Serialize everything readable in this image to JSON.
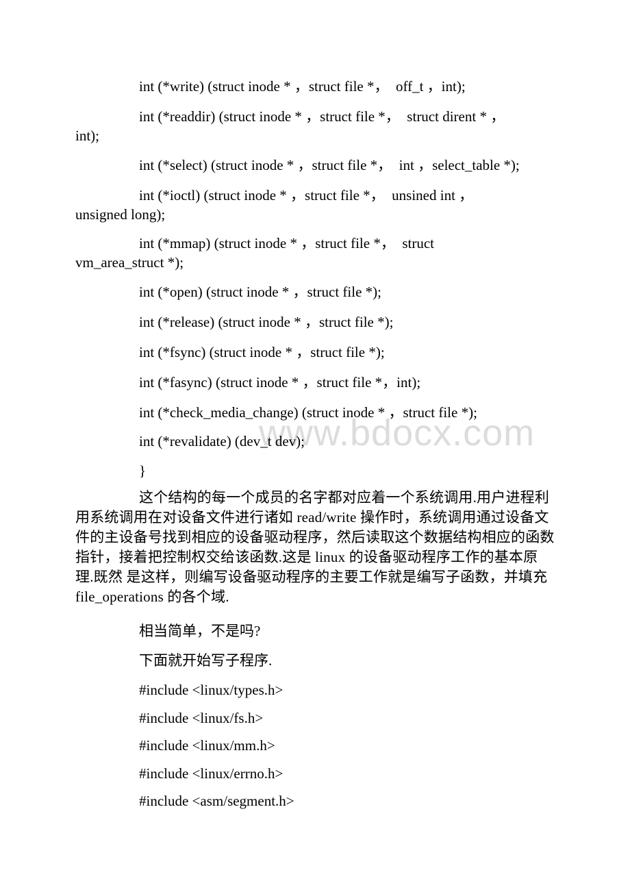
{
  "watermark": "www.bdocx.com",
  "struct_members": [
    {
      "line1": "int (*write) (struct inode * ，struct file *，  off_t ，int);",
      "line2": null
    },
    {
      "line1": "int (*readdir) (struct inode * ，struct file *，  struct dirent * ，",
      "line2": "int);"
    },
    {
      "line1": "int (*select) (struct inode * ，struct file *，  int ，select_table *);",
      "line2": null
    },
    {
      "line1": "int (*ioctl) (struct inode * ，struct file *，  unsined int ，",
      "line2": "unsigned long);"
    },
    {
      "line1": "int (*mmap) (struct inode * ，struct file *，  struct",
      "line2": "vm_area_struct *);"
    },
    {
      "line1": "int (*open) (struct inode * ，struct file *);",
      "line2": null
    },
    {
      "line1": "int (*release) (struct inode * ，struct file *);",
      "line2": null
    },
    {
      "line1": "int (*fsync) (struct inode * ，struct file *);",
      "line2": null
    },
    {
      "line1": "int (*fasync) (struct inode * ，struct file *，int);",
      "line2": null
    },
    {
      "line1": "int (*check_media_change) (struct inode * ，struct file *);",
      "line2": null
    },
    {
      "line1": "int (*revalidate) (dev_t dev);",
      "line2": null
    }
  ],
  "closing_brace": "}",
  "explanation_paragraph": "这个结构的每一个成员的名字都对应着一个系统调用.用户进程利用系统调用在对设备文件进行诸如 read/write 操作时，系统调用通过设备文 件的主设备号找到相应的设备驱动程序，然后读取这个数据结构相应的函数指针，接着把控制权交给该函数.这是 linux 的设备驱动程序工作的基本原理.既然 是这样，则编写设备驱动程序的主要工作就是编写子函数，并填充 file_operations 的各个域.",
  "question_line": "相当简单，不是吗?",
  "intro_line": "下面就开始写子程序.",
  "includes": [
    "#include <linux/types.h>",
    "#include <linux/fs.h>",
    "#include <linux/mm.h>",
    "#include <linux/errno.h>",
    "#include <asm/segment.h>"
  ]
}
